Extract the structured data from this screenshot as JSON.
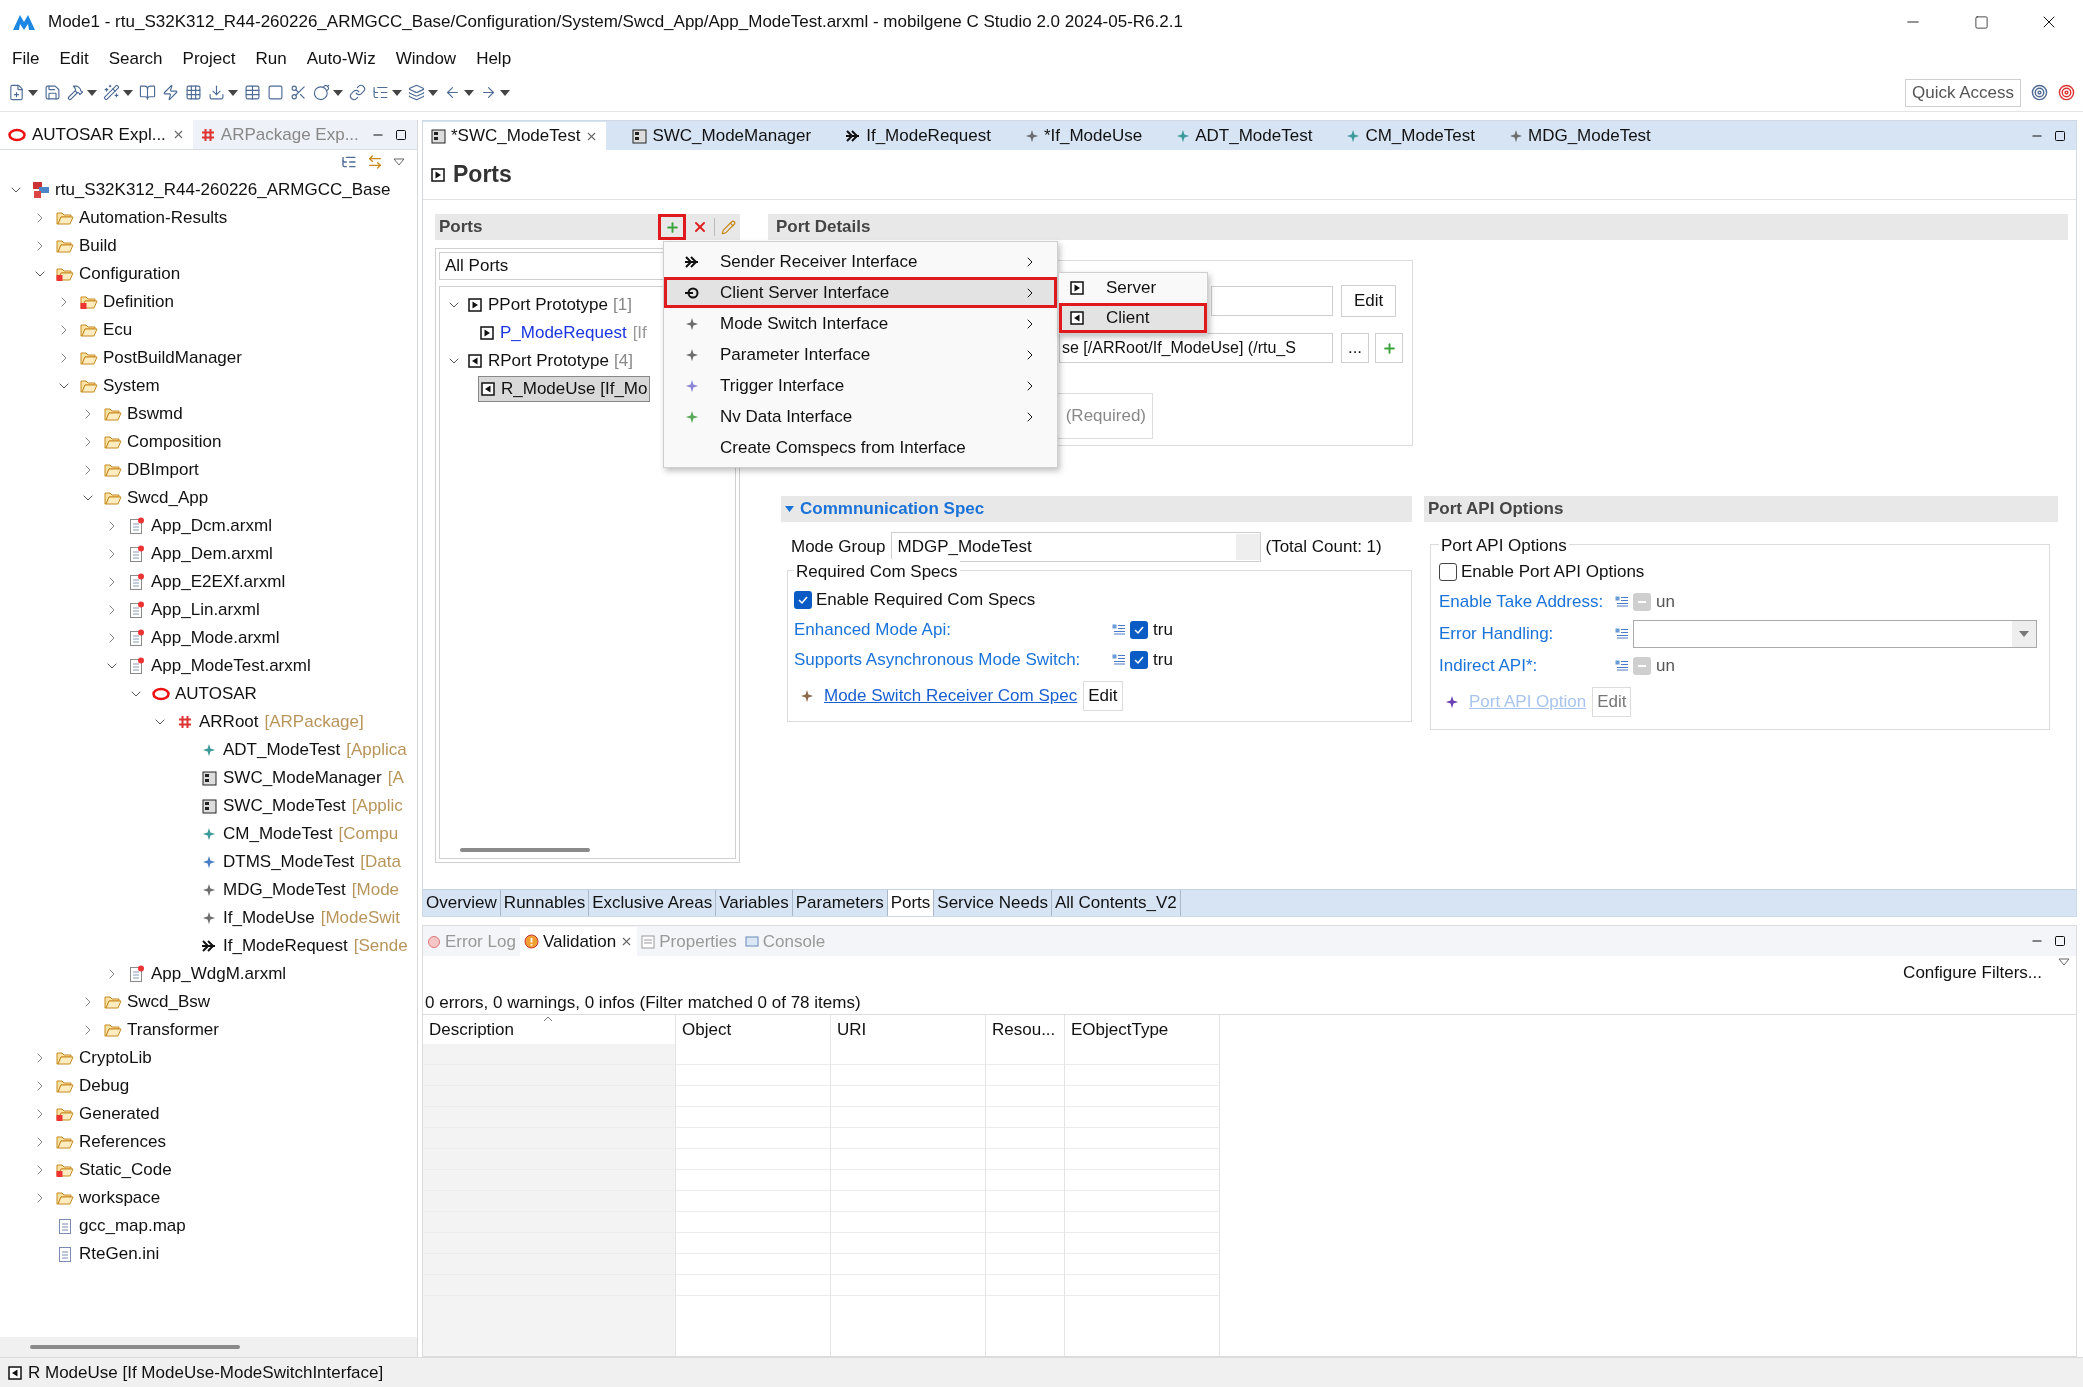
{
  "window": {
    "title": "Mode1 - rtu_S32K312_R44-260226_ARMGCC_Base/Configuration/System/Swcd_App/App_ModeTest.arxml - mobilgene C Studio 2.0 2024-05-R6.2.1"
  },
  "menu_bar": [
    "File",
    "Edit",
    "Search",
    "Project",
    "Run",
    "Auto-Wiz",
    "Window",
    "Help"
  ],
  "toolbar": {
    "quick_access": "Quick Access"
  },
  "explorer": {
    "tabs": [
      {
        "label": "AUTOSAR Expl...",
        "kind": "autosar",
        "selected": true
      },
      {
        "label": "ARPackage Exp...",
        "kind": "package",
        "selected": false
      }
    ],
    "tree": [
      {
        "label": "rtu_S32K312_R44-260226_ARMGCC_Base",
        "kind": "project",
        "expanded": true,
        "children": [
          {
            "label": "Automation-Results",
            "kind": "folder",
            "expanded": false
          },
          {
            "label": "Build",
            "kind": "folder",
            "expanded": false
          },
          {
            "label": "Configuration",
            "kind": "folder-error",
            "expanded": true,
            "children": [
              {
                "label": "Definition",
                "kind": "folder-error",
                "expanded": false
              },
              {
                "label": "Ecu",
                "kind": "folder",
                "expanded": false
              },
              {
                "label": "PostBuildManager",
                "kind": "folder",
                "expanded": false
              },
              {
                "label": "System",
                "kind": "folder",
                "expanded": true,
                "children": [
                  {
                    "label": "Bswmd",
                    "kind": "folder",
                    "expanded": false
                  },
                  {
                    "label": "Composition",
                    "kind": "folder",
                    "expanded": false
                  },
                  {
                    "label": "DBImport",
                    "kind": "folder",
                    "expanded": false
                  },
                  {
                    "label": "Swcd_App",
                    "kind": "folder",
                    "expanded": true,
                    "children": [
                      {
                        "label": "App_Dcm.arxml",
                        "kind": "arxml",
                        "expanded": false
                      },
                      {
                        "label": "App_Dem.arxml",
                        "kind": "arxml",
                        "expanded": false
                      },
                      {
                        "label": "App_E2EXf.arxml",
                        "kind": "arxml",
                        "expanded": false
                      },
                      {
                        "label": "App_Lin.arxml",
                        "kind": "arxml",
                        "expanded": false
                      },
                      {
                        "label": "App_Mode.arxml",
                        "kind": "arxml",
                        "expanded": false
                      },
                      {
                        "label": "App_ModeTest.arxml",
                        "kind": "arxml",
                        "expanded": true,
                        "children": [
                          {
                            "label": "AUTOSAR",
                            "kind": "autosar",
                            "expanded": true,
                            "children": [
                              {
                                "label": "ARRoot",
                                "suffix": "[ARPackage]",
                                "kind": "package",
                                "expanded": true,
                                "children": [
                                  {
                                    "label": "ADT_ModeTest",
                                    "suffix": "[Applica",
                                    "kind": "datatype"
                                  },
                                  {
                                    "label": "SWC_ModeManager",
                                    "suffix": "[A",
                                    "kind": "component"
                                  },
                                  {
                                    "label": "SWC_ModeTest",
                                    "suffix": "[Applic",
                                    "kind": "component"
                                  },
                                  {
                                    "label": "CM_ModeTest",
                                    "suffix": "[Compu",
                                    "kind": "datatype"
                                  },
                                  {
                                    "label": "DTMS_ModeTest",
                                    "suffix": "[Data",
                                    "kind": "mapping"
                                  },
                                  {
                                    "label": "MDG_ModeTest",
                                    "suffix": "[Mode",
                                    "kind": "mode"
                                  },
                                  {
                                    "label": "If_ModeUse",
                                    "suffix": "[ModeSwit",
                                    "kind": "mode"
                                  },
                                  {
                                    "label": "If_ModeRequest",
                                    "suffix": "[Sende",
                                    "kind": "sender"
                                  }
                                ]
                              }
                            ]
                          }
                        ]
                      },
                      {
                        "label": "App_WdgM.arxml",
                        "kind": "arxml",
                        "expanded": false
                      }
                    ]
                  },
                  {
                    "label": "Swcd_Bsw",
                    "kind": "folder",
                    "expanded": false
                  },
                  {
                    "label": "Transformer",
                    "kind": "folder",
                    "expanded": false
                  }
                ]
              }
            ]
          },
          {
            "label": "CryptoLib",
            "kind": "folder",
            "expanded": false
          },
          {
            "label": "Debug",
            "kind": "folder",
            "expanded": false
          },
          {
            "label": "Generated",
            "kind": "folder-error",
            "expanded": false
          },
          {
            "label": "References",
            "kind": "folder",
            "expanded": false
          },
          {
            "label": "Static_Code",
            "kind": "folder-error",
            "expanded": false
          },
          {
            "label": "workspace",
            "kind": "folder",
            "expanded": false
          },
          {
            "label": "gcc_map.map",
            "kind": "file"
          },
          {
            "label": "RteGen.ini",
            "kind": "file"
          }
        ]
      }
    ]
  },
  "editor": {
    "tabs": [
      {
        "label": "*SWC_ModeTest",
        "kind": "component",
        "selected": true
      },
      {
        "label": "SWC_ModeManager",
        "kind": "component",
        "selected": false
      },
      {
        "label": "If_ModeRequest",
        "kind": "sender",
        "selected": false
      },
      {
        "label": "*If_ModeUse",
        "kind": "mode",
        "selected": false
      },
      {
        "label": "ADT_ModeTest",
        "kind": "datatype",
        "selected": false
      },
      {
        "label": "CM_ModeTest",
        "kind": "datatype",
        "selected": false
      },
      {
        "label": "MDG_ModeTest",
        "kind": "mode",
        "selected": false
      }
    ],
    "page_title": "Ports",
    "ports": {
      "title": "Ports",
      "add_annotated": true,
      "filter": "All Ports",
      "tree": [
        {
          "label": "PPort Prototype",
          "count": "[1]",
          "kind": "pport",
          "expanded": true,
          "children": [
            {
              "label": "P_ModeRequest",
              "suffix": "[If",
              "kind": "pport",
              "selected": false
            }
          ]
        },
        {
          "label": "RPort Prototype",
          "count": "[4]",
          "kind": "rport",
          "expanded": true,
          "children": [
            {
              "label": "R_ModeUse [If_Mo",
              "kind": "rport",
              "selected": true
            }
          ]
        }
      ]
    },
    "port_details": {
      "title": "Port Details",
      "edit_button": "Edit",
      "reference": "se [/ARRoot/If_ModeUse] (/rtu_S",
      "browse_button": "...",
      "direction": "(Required)"
    },
    "communication_spec": {
      "title": "Commnunication Spec",
      "expanded": true,
      "mode_group_label": "Mode Group",
      "mode_group": "MDGP_ModeTest",
      "total_count": "(Total Count: 1)",
      "group_title": "Required Com Specs",
      "enable": {
        "label": "Enable Required Com Specs",
        "checked": true
      },
      "options": [
        {
          "kind": "checkbox",
          "label": "Enhanced Mode Api:",
          "checked": true,
          "disabled": false,
          "value": "tru"
        },
        {
          "kind": "checkbox",
          "label": "Supports Asynchronous Mode Switch:",
          "checked": true,
          "disabled": false,
          "value": "tru"
        }
      ],
      "link": "Mode Switch Receiver Com Spec",
      "link_disabled": false,
      "edit_button": "Edit"
    },
    "port_api_options": {
      "title": "Port API Options",
      "group_title": "Port API Options",
      "enable": {
        "label": "Enable Port API Options",
        "checked": false
      },
      "options": [
        {
          "kind": "checkbox",
          "label": "Enable Take Address:",
          "checked": false,
          "disabled": true,
          "value": "un"
        },
        {
          "kind": "combo",
          "label": "Error Handling:"
        },
        {
          "kind": "checkbox",
          "label": "Indirect API*:",
          "checked": false,
          "disabled": true,
          "value": "un"
        }
      ],
      "link": "Port API Option",
      "link_disabled": true,
      "edit_button": "Edit"
    },
    "page_tabs": [
      {
        "label": "Overview",
        "selected": false
      },
      {
        "label": "Runnables",
        "selected": false
      },
      {
        "label": "Exclusive Areas",
        "selected": false
      },
      {
        "label": "Variables",
        "selected": false
      },
      {
        "label": "Parameters",
        "selected": false
      },
      {
        "label": "Ports",
        "selected": true
      },
      {
        "label": "Service Needs",
        "selected": false
      },
      {
        "label": "All Contents_V2",
        "selected": false
      }
    ],
    "context_menu": {
      "items": [
        {
          "label": "Sender Receiver Interface",
          "kind": "sender",
          "submenu": true,
          "selected": false,
          "annotated": false
        },
        {
          "label": "Client Server Interface",
          "kind": "client-server",
          "submenu": true,
          "selected": true,
          "annotated": true
        },
        {
          "label": "Mode Switch Interface",
          "kind": "mode",
          "submenu": true,
          "selected": false,
          "annotated": false
        },
        {
          "label": "Parameter Interface",
          "kind": "mode",
          "submenu": true,
          "selected": false,
          "annotated": false
        },
        {
          "label": "Trigger Interface",
          "kind": "trigger",
          "submenu": true,
          "selected": false,
          "annotated": false
        },
        {
          "label": "Nv Data Interface",
          "kind": "nvdata",
          "submenu": true,
          "selected": false,
          "annotated": false
        },
        {
          "label": "Create Comspecs from Interface",
          "submenu": false,
          "selected": false,
          "annotated": false
        }
      ],
      "submenu": [
        {
          "label": "Server",
          "kind": "pport",
          "selected": false,
          "annotated": false
        },
        {
          "label": "Client",
          "kind": "rport",
          "selected": true,
          "annotated": true
        }
      ]
    }
  },
  "problems": {
    "tabs": [
      {
        "label": "Error Log",
        "kind": "error-log",
        "selected": false
      },
      {
        "label": "Validation",
        "kind": "validation",
        "selected": true
      },
      {
        "label": "Properties",
        "kind": "properties",
        "selected": false
      },
      {
        "label": "Console",
        "kind": "console",
        "selected": false
      }
    ],
    "configure": "Configure Filters...",
    "summary": "0 errors, 0 warnings, 0 infos (Filter matched 0 of 78 items)",
    "columns": [
      "Description",
      "Object",
      "URI",
      "Resou...",
      "EObjectType"
    ]
  },
  "status_bar": "R ModeUse [If ModeUse-ModeSwitchInterface]"
}
